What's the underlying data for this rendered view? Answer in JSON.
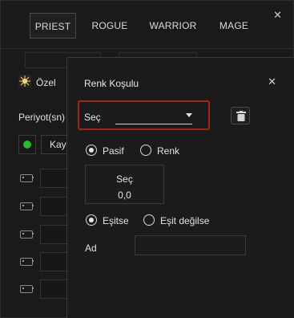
{
  "class_tabs": [
    {
      "label": "PRIEST",
      "active": true
    },
    {
      "label": "ROGUE",
      "active": false
    },
    {
      "label": "WARRIOR",
      "active": false
    },
    {
      "label": "MAGE",
      "active": false
    }
  ],
  "window": {
    "close_icon": "close-icon"
  },
  "background_panel": {
    "special_label": "Özel",
    "special_icon": "sparkle-icon",
    "period_label": "Periyot(sn)",
    "toggle_color": "#1fbf2a",
    "record_button_label": "Kay",
    "key_rows": [
      {
        "icon": "keyboard-icon"
      },
      {
        "icon": "keyboard-icon"
      },
      {
        "icon": "keyboard-icon"
      },
      {
        "icon": "keyboard-icon"
      },
      {
        "icon": "keyboard-icon"
      }
    ]
  },
  "color_condition_dialog": {
    "title": "Renk Koşulu",
    "close_icon": "close-icon",
    "select": {
      "label": "Seç",
      "value": ""
    },
    "highlight_color": "#a52418",
    "delete_icon": "trash-icon",
    "mode_options": [
      {
        "label": "Pasif",
        "checked": true
      },
      {
        "label": "Renk",
        "checked": false
      }
    ],
    "value_box": {
      "label": "Seç",
      "value": "0,0"
    },
    "compare_options": [
      {
        "label": "Eşitse",
        "checked": true
      },
      {
        "label": "Eşit değilse",
        "checked": false
      }
    ],
    "name_field": {
      "label": "Ad",
      "value": "",
      "placeholder": ""
    }
  }
}
